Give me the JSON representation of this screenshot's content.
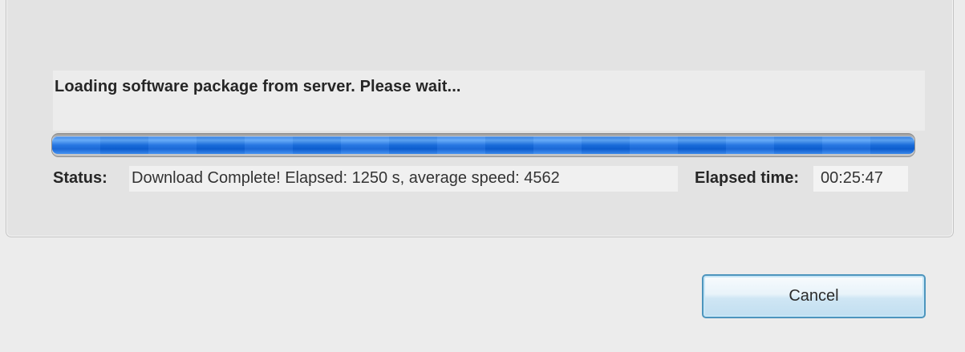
{
  "dialog": {
    "message": "Loading software package from server. Please wait...",
    "progress": {
      "percent": 100
    },
    "status": {
      "label": "Status:",
      "value": "Download Complete! Elapsed: 1250 s, average speed: 4562"
    },
    "elapsed_time": {
      "label": "Elapsed time:",
      "value": "00:25:47"
    },
    "buttons": {
      "cancel_label": "Cancel"
    }
  },
  "colors": {
    "progress_fill": "#1a6fe0",
    "button_border": "#4d95bd",
    "background": "#ececec"
  }
}
